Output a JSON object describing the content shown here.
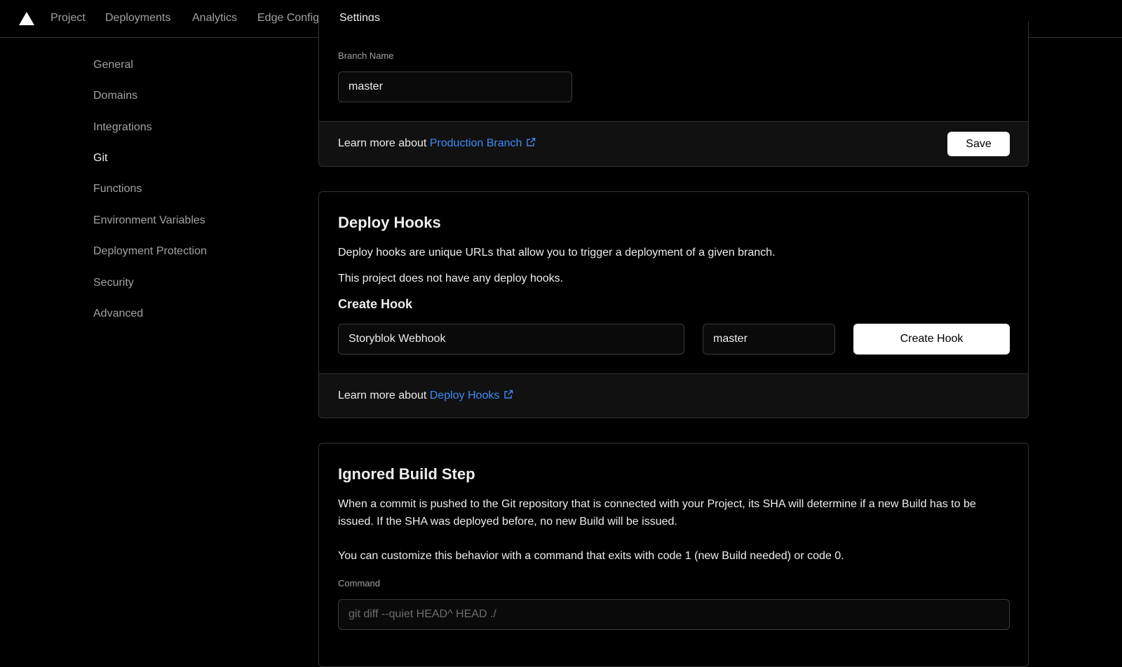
{
  "nav": {
    "tabs": [
      {
        "label": "Project"
      },
      {
        "label": "Deployments"
      },
      {
        "label": "Analytics"
      },
      {
        "label": "Edge Config"
      },
      {
        "label": "Settings"
      }
    ],
    "active_tab": "Settings"
  },
  "sidebar": {
    "items": [
      {
        "label": "General"
      },
      {
        "label": "Domains"
      },
      {
        "label": "Integrations"
      },
      {
        "label": "Git"
      },
      {
        "label": "Functions"
      },
      {
        "label": "Environment Variables"
      },
      {
        "label": "Deployment Protection"
      },
      {
        "label": "Security"
      },
      {
        "label": "Advanced"
      }
    ],
    "active_item": "Git"
  },
  "production_branch": {
    "field_label": "Branch Name",
    "value": "master",
    "footer_prefix": "Learn more about ",
    "footer_link": "Production Branch",
    "save_label": "Save"
  },
  "deploy_hooks": {
    "title": "Deploy Hooks",
    "description": "Deploy hooks are unique URLs that allow you to trigger a deployment of a given branch.",
    "empty_text": "This project does not have any deploy hooks.",
    "create_title": "Create Hook",
    "name_value": "Storyblok Webhook",
    "branch_value": "master",
    "create_button": "Create Hook",
    "footer_prefix": "Learn more about ",
    "footer_link": "Deploy Hooks"
  },
  "ignored_build_step": {
    "title": "Ignored Build Step",
    "description": "When a commit is pushed to the Git repository that is connected with your Project, its SHA will determine if a new Build has to be issued. If the SHA was deployed before, no new Build will be issued.",
    "customize_text": "You can customize this behavior with a command that exits with code 1 (new Build needed) or code 0.",
    "command_label": "Command",
    "command_placeholder": "git diff --quiet HEAD^ HEAD ./"
  },
  "colors": {
    "background": "#000000",
    "link": "#3b8cf5",
    "footer_background": "#111111",
    "border": "#333333"
  }
}
